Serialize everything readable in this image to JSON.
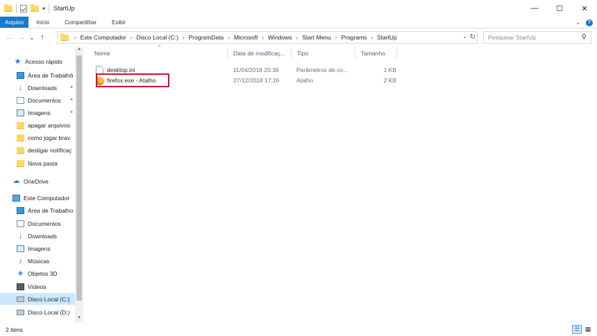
{
  "window": {
    "title": "StartUp",
    "qat_dropdown_glyph": "▾",
    "controls": [
      "—",
      "☐",
      "✕"
    ]
  },
  "ribbon": {
    "tabs": [
      "Arquivo",
      "Início",
      "Compartilhar",
      "Exibir"
    ],
    "expand_glyph": "⌄",
    "help_glyph": "?"
  },
  "nav": {
    "back": "←",
    "forward": "→",
    "recent": "⌄",
    "up": "↑"
  },
  "address": {
    "crumbs": [
      "Este Computador",
      "Disco Local (C:)",
      "ProgramData",
      "Microsoft",
      "Windows",
      "Start Menu",
      "Programs",
      "StartUp"
    ],
    "separator": "›",
    "dropdown_glyph": "⌄",
    "refresh_glyph": "↻"
  },
  "search": {
    "placeholder": "Pesquisar StartUp",
    "icon_glyph": "⚲"
  },
  "sidebar": {
    "items": [
      {
        "label": "Acesso rápido",
        "icon": "star-icon"
      },
      {
        "label": "Área de Trabalho",
        "icon": "desktop-icon",
        "pinned": true
      },
      {
        "label": "Downloads",
        "icon": "download-icon",
        "pinned": true
      },
      {
        "label": "Documentos",
        "icon": "document-icon",
        "pinned": true
      },
      {
        "label": "Imagens",
        "icon": "pictures-icon",
        "pinned": true
      },
      {
        "label": "apagar arquivos",
        "icon": "folder-icon"
      },
      {
        "label": "como jogar brav",
        "icon": "folder-icon"
      },
      {
        "label": "desligar notificaç",
        "icon": "folder-icon"
      },
      {
        "label": "Nova pasta",
        "icon": "folder-icon"
      },
      {
        "label": "OneDrive",
        "icon": "cloud-icon"
      },
      {
        "label": "Este Computador",
        "icon": "computer-icon"
      },
      {
        "label": "Área de Trabalho",
        "icon": "desktop-icon"
      },
      {
        "label": "Documentos",
        "icon": "document-icon"
      },
      {
        "label": "Downloads",
        "icon": "download-icon"
      },
      {
        "label": "Imagens",
        "icon": "pictures-icon"
      },
      {
        "label": "Músicas",
        "icon": "music-icon"
      },
      {
        "label": "Objetos 3D",
        "icon": "objects-3d-icon"
      },
      {
        "label": "Vídeos",
        "icon": "video-icon"
      },
      {
        "label": "Disco Local (C:)",
        "icon": "drive-icon",
        "selected": true
      },
      {
        "label": "Disco Local (D:)",
        "icon": "drive-icon"
      }
    ],
    "pin_glyph": "📌"
  },
  "file_list": {
    "columns": [
      "Nome",
      "Data de modificaç...",
      "Tipo",
      "Tamanho"
    ],
    "sort_glyph": "^",
    "rows": [
      {
        "name": "desktop.ini",
        "date": "11/04/2018 20:36",
        "type": "Parâmetros de co...",
        "size": "1 KB",
        "icon": "ini-file-icon"
      },
      {
        "name": "firefox.exe - Atalho",
        "date": "27/12/2018 17:26",
        "type": "Atalho",
        "size": "2 KB",
        "icon": "firefox-icon",
        "highlighted": true
      }
    ]
  },
  "status": {
    "item_count": "2 itens"
  },
  "colors": {
    "accent": "#1979ca",
    "highlight_border": "#c8102e",
    "selected_bg": "#cce8ff"
  }
}
